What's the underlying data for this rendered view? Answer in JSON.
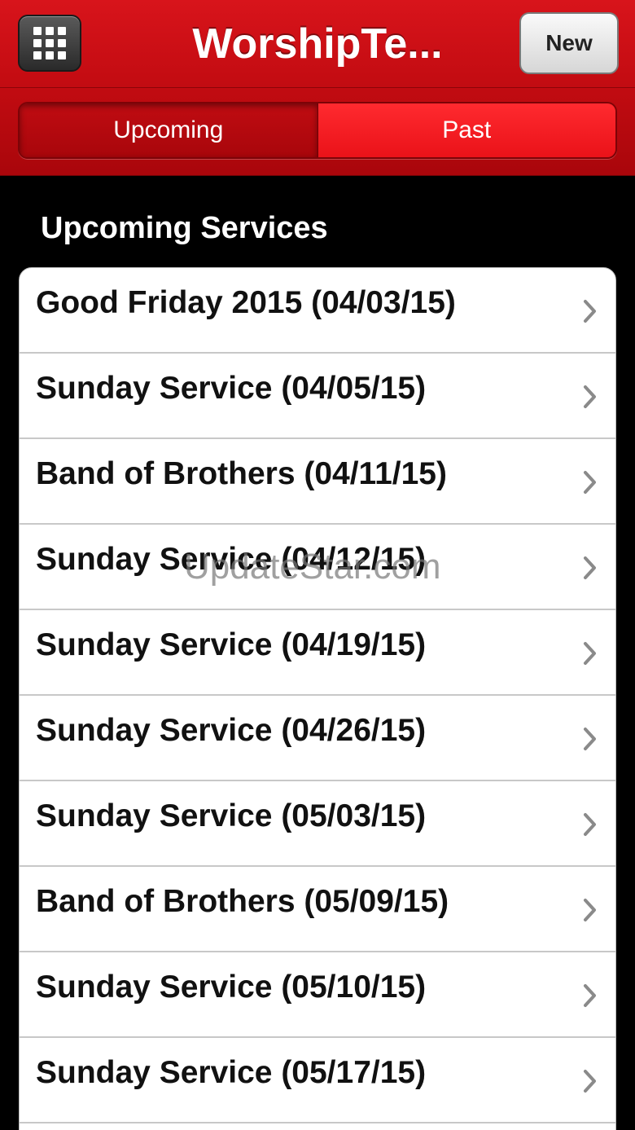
{
  "navbar": {
    "menu_icon": "grid-icon",
    "title": "WorshipTe...",
    "new_label": "New"
  },
  "tabs": {
    "upcoming_label": "Upcoming",
    "past_label": "Past",
    "selected": "Upcoming"
  },
  "section_title": "Upcoming Services",
  "services": [
    {
      "label": "Good Friday 2015 (04/03/15)"
    },
    {
      "label": "Sunday Service (04/05/15)"
    },
    {
      "label": "Band of Brothers (04/11/15)"
    },
    {
      "label": "Sunday Service (04/12/15)"
    },
    {
      "label": "Sunday Service (04/19/15)"
    },
    {
      "label": "Sunday Service (04/26/15)"
    },
    {
      "label": "Sunday Service (05/03/15)"
    },
    {
      "label": "Band of Brothers (05/09/15)"
    },
    {
      "label": "Sunday Service (05/10/15)"
    },
    {
      "label": "Sunday Service (05/17/15)"
    }
  ],
  "watermark": "UpdateStar.com",
  "colors": {
    "brand_red": "#c40c12",
    "active_segment": "#ff2a2f",
    "background": "#000000"
  }
}
